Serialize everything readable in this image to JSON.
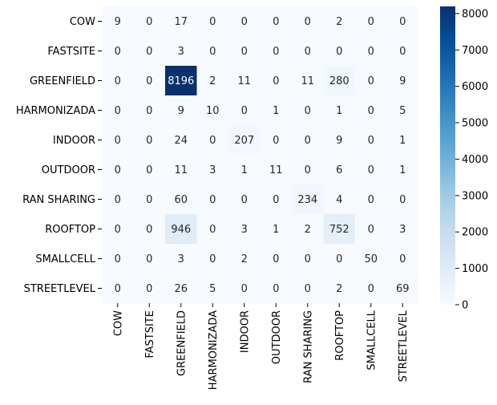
{
  "chart_data": {
    "type": "heatmap",
    "rows": [
      "COW",
      "FASTSITE",
      "GREENFIELD",
      "HARMONIZADA",
      "INDOOR",
      "OUTDOOR",
      "RAN SHARING",
      "ROOFTOP",
      "SMALLCELL",
      "STREETLEVEL"
    ],
    "columns": [
      "COW",
      "FASTSITE",
      "GREENFIELD",
      "HARMONIZADA",
      "INDOOR",
      "OUTDOOR",
      "RAN SHARING",
      "ROOFTOP",
      "SMALLCELL",
      "STREETLEVEL"
    ],
    "values": [
      [
        9,
        0,
        17,
        0,
        0,
        0,
        0,
        2,
        0,
        0
      ],
      [
        0,
        0,
        3,
        0,
        0,
        0,
        0,
        0,
        0,
        0
      ],
      [
        0,
        0,
        8196,
        2,
        11,
        0,
        11,
        280,
        0,
        9
      ],
      [
        0,
        0,
        9,
        10,
        0,
        1,
        0,
        1,
        0,
        5
      ],
      [
        0,
        0,
        24,
        0,
        207,
        0,
        0,
        9,
        0,
        1
      ],
      [
        0,
        0,
        11,
        3,
        1,
        11,
        0,
        6,
        0,
        1
      ],
      [
        0,
        0,
        60,
        0,
        0,
        0,
        234,
        4,
        0,
        0
      ],
      [
        0,
        0,
        946,
        0,
        3,
        1,
        2,
        752,
        0,
        3
      ],
      [
        0,
        0,
        3,
        0,
        2,
        0,
        0,
        0,
        50,
        0
      ],
      [
        0,
        0,
        26,
        5,
        0,
        0,
        0,
        2,
        0,
        69
      ]
    ],
    "colorbar": {
      "colormap": "Blues",
      "min": 0,
      "max": 8196,
      "ticks": [
        0,
        1000,
        2000,
        3000,
        4000,
        5000,
        6000,
        7000,
        8000
      ]
    },
    "annotations": "cell values shown in each cell",
    "title": "",
    "xlabel": "",
    "ylabel": ""
  }
}
